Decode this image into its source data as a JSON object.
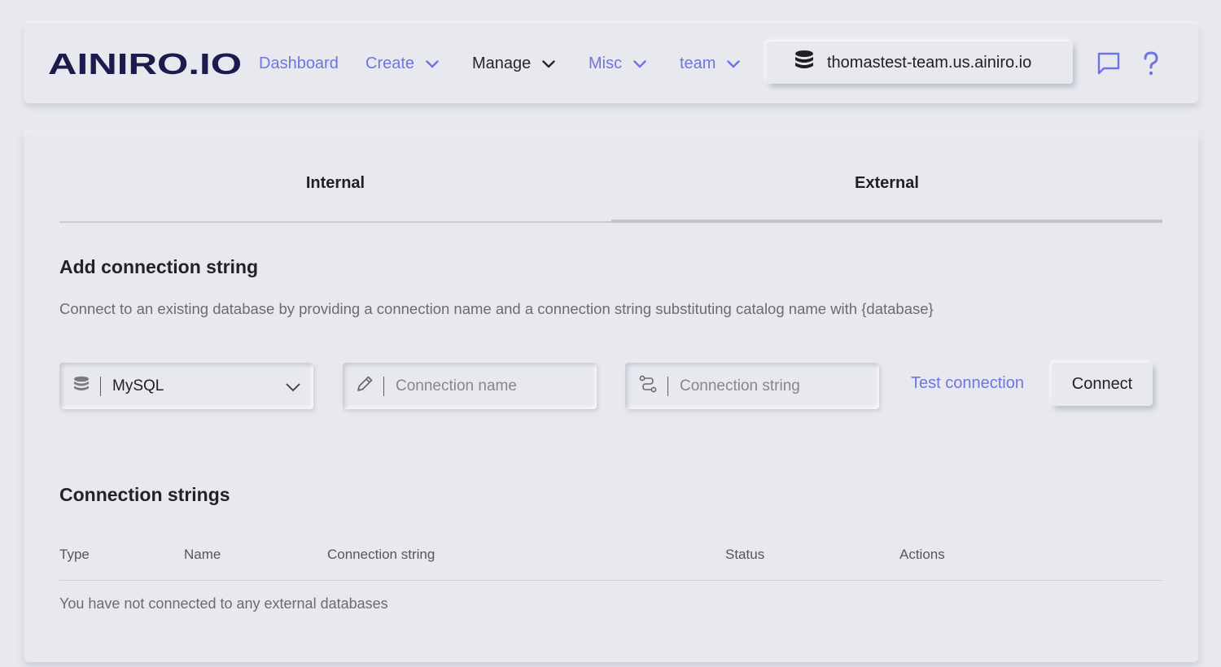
{
  "header": {
    "logo_text": "AINIRO.IO",
    "nav": [
      {
        "label": "Dashboard",
        "dropdown": false,
        "style": "link"
      },
      {
        "label": "Create",
        "dropdown": true,
        "style": "link"
      },
      {
        "label": "Manage",
        "dropdown": true,
        "style": "dark"
      },
      {
        "label": "Misc",
        "dropdown": true,
        "style": "link"
      },
      {
        "label": "team",
        "dropdown": true,
        "style": "link"
      }
    ],
    "database_host": "thomastest-team.us.ainiro.io",
    "icons": [
      "database-icon",
      "chat-icon",
      "help-icon"
    ]
  },
  "tabs": [
    {
      "label": "Internal",
      "active": false
    },
    {
      "label": "External",
      "active": true
    }
  ],
  "add_section": {
    "title": "Add connection string",
    "description": "Connect to an existing database by providing a connection name and a connection string substituting catalog name with {database}",
    "db_type_selected": "MySQL",
    "connection_name_placeholder": "Connection name",
    "connection_string_placeholder": "Connection string",
    "test_label": "Test connection",
    "connect_label": "Connect"
  },
  "list_section": {
    "title": "Connection strings",
    "columns": [
      "Type",
      "Name",
      "Connection string",
      "Status",
      "Actions"
    ],
    "empty_message": "You have not connected to any external databases"
  },
  "colors": {
    "background": "#e8e9ef",
    "accent": "#6e74e2",
    "logo": "#1b1b4d",
    "text": "#1f1f24",
    "muted": "#6a6b73"
  }
}
